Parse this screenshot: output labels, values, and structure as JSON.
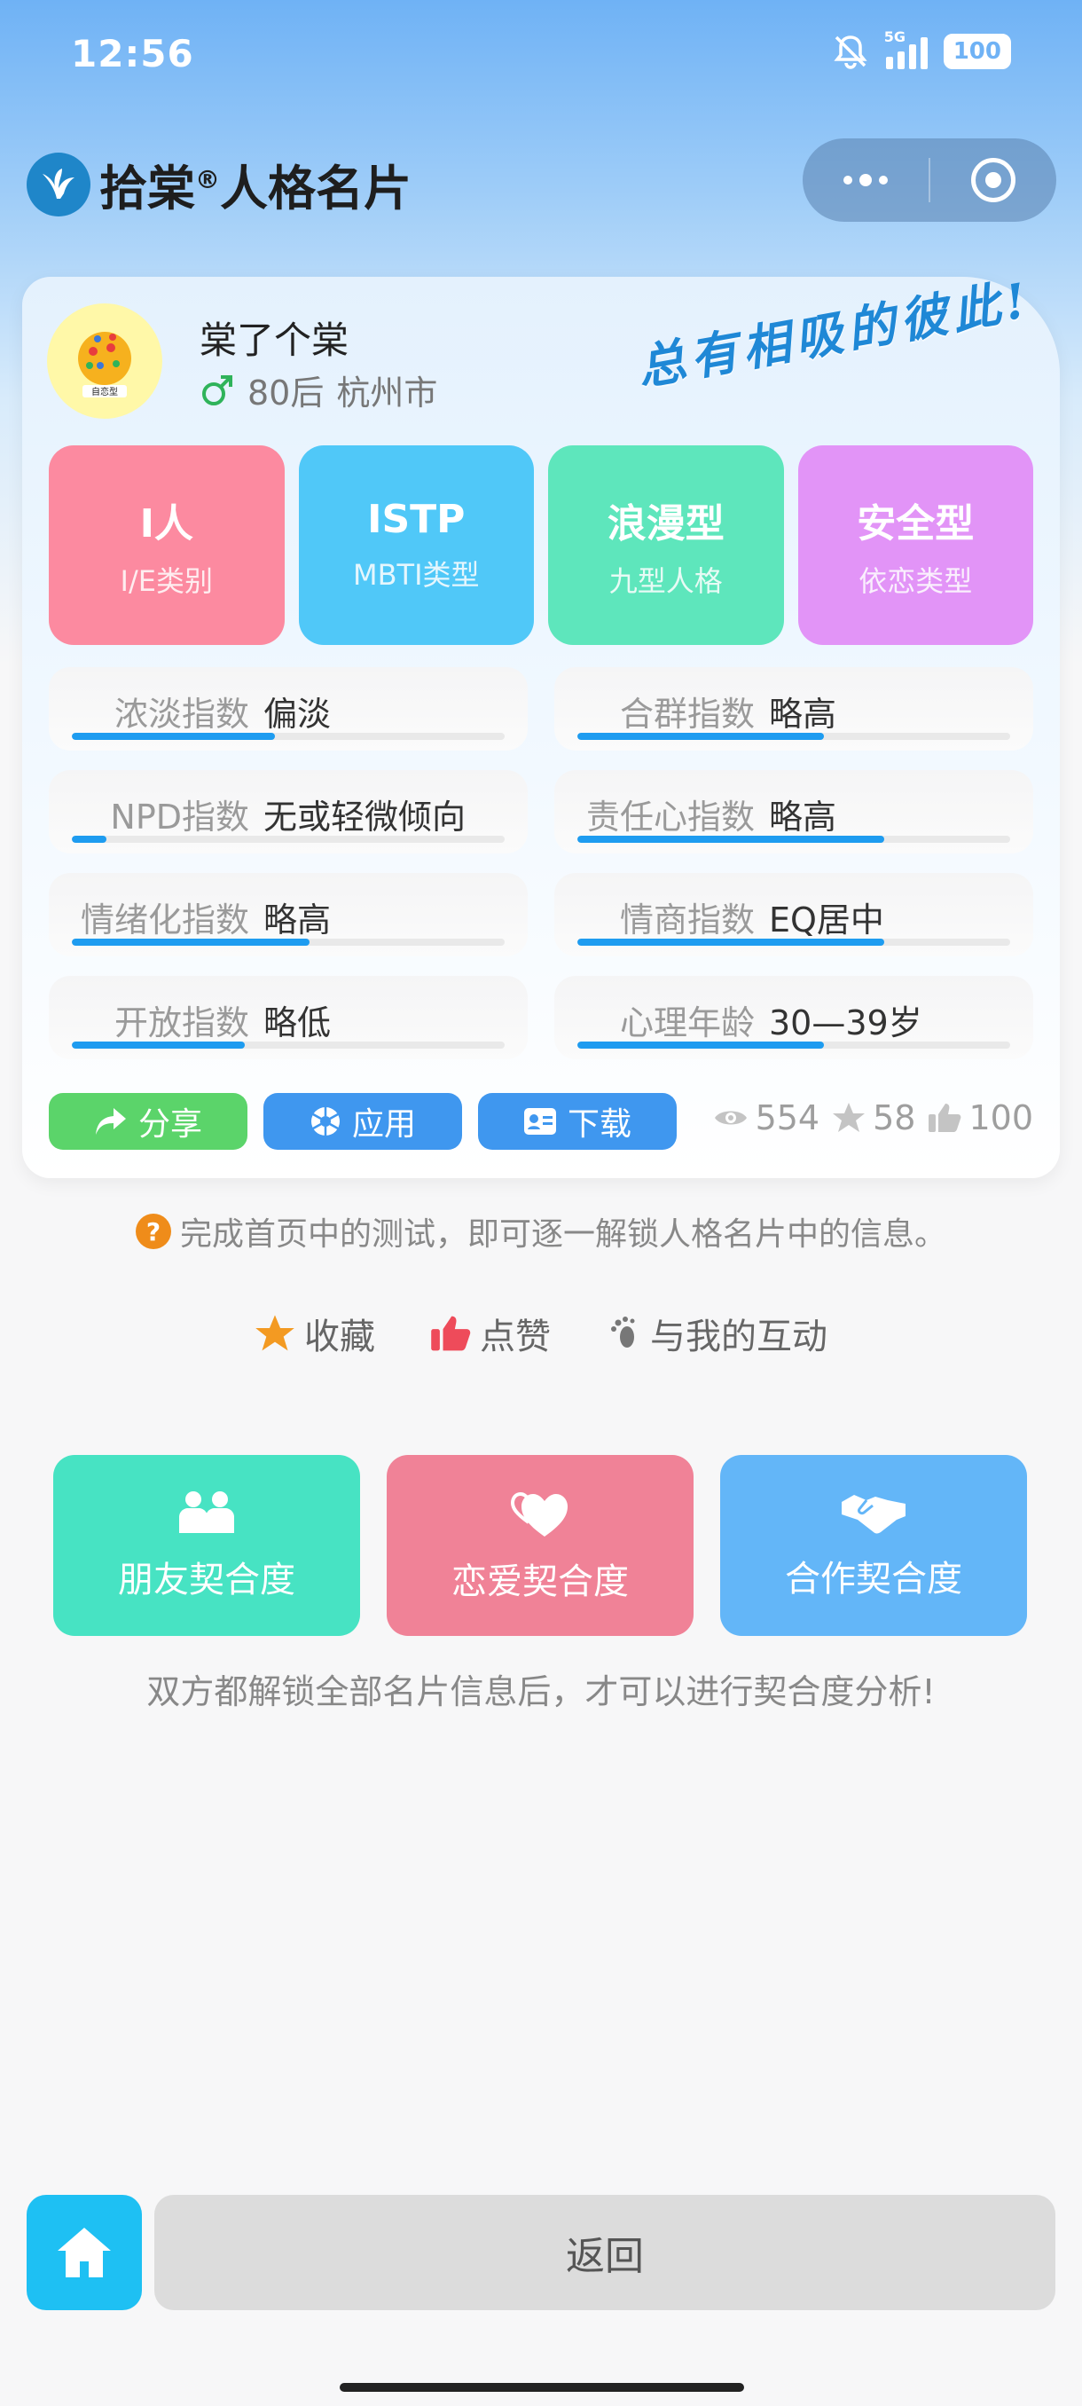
{
  "status": {
    "time": "12:56",
    "network": "5G",
    "battery": "100"
  },
  "header": {
    "title": "拾棠",
    "registered": "®",
    "subtitle": "人格名片"
  },
  "profile": {
    "avatar_caption": "自恋型",
    "name": "棠了个棠",
    "generation": "80后",
    "city": "杭州市",
    "slogan": "总有相吸的彼此!"
  },
  "types": [
    {
      "value": "I人",
      "label": "I/E类别"
    },
    {
      "value": "ISTP",
      "label": "MBTI类型"
    },
    {
      "value": "浪漫型",
      "label": "九型人格"
    },
    {
      "value": "安全型",
      "label": "依恋类型"
    }
  ],
  "metrics": [
    {
      "label": "浓淡指数",
      "value": "偏淡",
      "level": 0.47
    },
    {
      "label": "合群指数",
      "value": "略高",
      "level": 0.57
    },
    {
      "label": "NPD指数",
      "value": "无或轻微倾向",
      "level": 0.08
    },
    {
      "label": "责任心指数",
      "value": "略高",
      "level": 0.71
    },
    {
      "label": "情绪化指数",
      "value": "略高",
      "level": 0.55
    },
    {
      "label": "情商指数",
      "value": "EQ居中",
      "level": 0.71
    },
    {
      "label": "开放指数",
      "value": "略低",
      "level": 0.4
    },
    {
      "label": "心理年龄",
      "value": "30—39岁",
      "level": 0.57
    }
  ],
  "actions": {
    "share": "分享",
    "apply": "应用",
    "download": "下载"
  },
  "stats": {
    "views": "554",
    "favorites": "58",
    "likes": "100"
  },
  "hint": "完成首页中的测试，即可逐一解锁人格名片中的信息。",
  "social": {
    "favorite": "收藏",
    "like": "点赞",
    "interact": "与我的互动"
  },
  "compat": {
    "friend": "朋友契合度",
    "love": "恋爱契合度",
    "work": "合作契合度",
    "note": "双方都解锁全部名片信息后，才可以进行契合度分析!"
  },
  "bottom": {
    "back": "返回"
  },
  "colors": {
    "accent_blue": "#1e9cf0",
    "share_green": "#5bd46a",
    "button_blue": "#3f97ef"
  }
}
